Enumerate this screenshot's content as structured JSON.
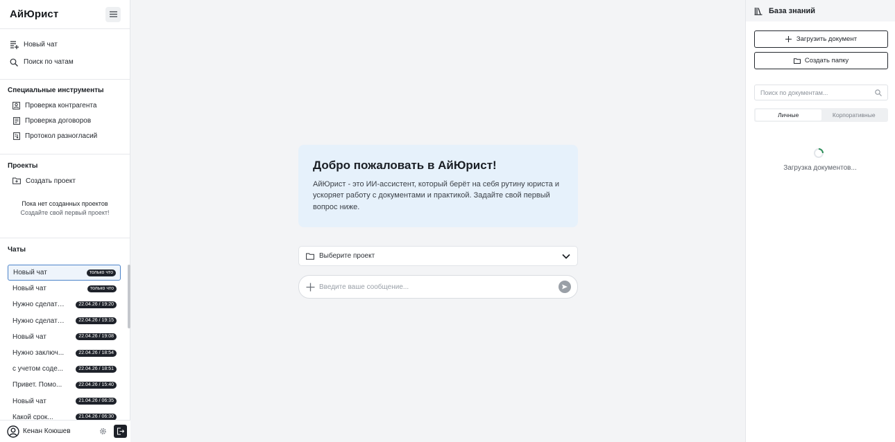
{
  "app": {
    "title": "АйЮрист"
  },
  "sidebar": {
    "nav": [
      {
        "icon": "new-chat-icon",
        "label": "Новый чат"
      },
      {
        "icon": "search-icon",
        "label": "Поиск по чатам"
      }
    ],
    "tools_title": "Специальные инструменты",
    "tools": [
      {
        "icon": "counterparty-icon",
        "label": "Проверка контрагента"
      },
      {
        "icon": "contract-check-icon",
        "label": "Проверка договоров"
      },
      {
        "icon": "disagreement-protocol-icon",
        "label": "Протокол разногласий"
      }
    ],
    "projects_title": "Проекты",
    "create_project": "Создать проект",
    "empty_projects_title": "Пока нет созданных проектов",
    "empty_projects_hint": "Создайте свой первый проект!",
    "chats_title": "Чаты",
    "chats": [
      {
        "title": "Новый чат",
        "badge": "только что",
        "active": true
      },
      {
        "title": "Новый чат",
        "badge": "только что"
      },
      {
        "title": "Нужно сделать...",
        "badge": "22.04.26 / 19:20"
      },
      {
        "title": "Нужно сделать...",
        "badge": "22.04.26 / 19:15"
      },
      {
        "title": "Новый чат",
        "badge": "22.04.26 / 19:08"
      },
      {
        "title": "Нужно заключ...",
        "badge": "22.04.26 / 18:54"
      },
      {
        "title": "с учетом соде...",
        "badge": "22.04.26 / 18:51"
      },
      {
        "title": "Привет. Помо...",
        "badge": "22.04.26 / 15:40"
      },
      {
        "title": "Новый чат",
        "badge": "21.04.26 / 06:35"
      },
      {
        "title": "Какой срок...",
        "badge": "21.04.26 / 06:30"
      }
    ],
    "user": {
      "name": "Кенан Коюшев"
    }
  },
  "main": {
    "welcome_title": "Добро пожаловать в АйЮрист!",
    "welcome_text": "АйЮрист - это ИИ-ассистент, который берёт на себя рутину юриста и ускоряет работу с документами и практикой. Задайте свой первый вопрос ниже.",
    "project_select_label": "Выберите проект",
    "message_placeholder": "Введите ваше сообщение..."
  },
  "knowledge_base": {
    "title": "База знаний",
    "upload_label": "Загрузить документ",
    "create_folder_label": "Создать папку",
    "search_placeholder": "Поиск по документам...",
    "tabs": [
      {
        "label": "Личные",
        "active": true
      },
      {
        "label": "Корпоративные"
      }
    ],
    "loading_text": "Загрузка документов..."
  },
  "colors": {
    "welcome_bg": "#e6f1fb",
    "active_chat_border": "#4b83c9",
    "badge_bg": "#1e222a"
  }
}
